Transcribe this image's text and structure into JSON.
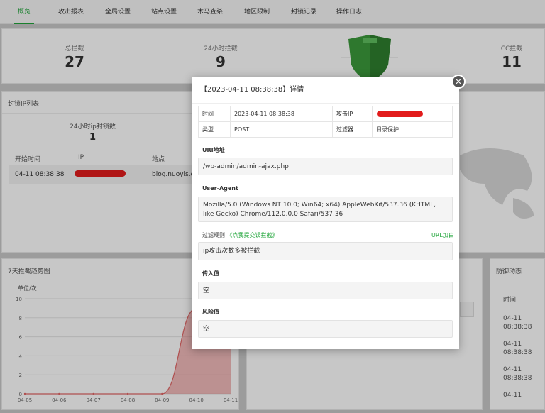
{
  "tabs": [
    "概览",
    "攻击报表",
    "全局设置",
    "站点设置",
    "木马查杀",
    "地区限制",
    "封锁记录",
    "操作日志"
  ],
  "stats": {
    "total_label": "总拦截",
    "total_value": "27",
    "day_label": "24小时拦截",
    "day_value": "9",
    "cc_label": "CC拦截",
    "cc_value": "11"
  },
  "ip_section": {
    "title": "封锁IP列表",
    "blocked_label": "24小时ip封锁数",
    "blocked_value": "1",
    "col_start": "开始时间",
    "col_ip": "IP",
    "col_site": "站点",
    "row_time": "04-11 08:38:38",
    "row_site": "blog.nuoyis.co"
  },
  "trend": {
    "title": "7天拦截趋势图",
    "unit": "单位/次",
    "y_ticks": [
      "0",
      "2",
      "4",
      "6",
      "8",
      "10"
    ],
    "x_ticks": [
      "04-05",
      "04-06",
      "04-07",
      "04-08",
      "04-09",
      "04-10",
      "04-11"
    ]
  },
  "chart_data": {
    "type": "area",
    "categories": [
      "04-05",
      "04-06",
      "04-07",
      "04-08",
      "04-09",
      "04-10",
      "04-11"
    ],
    "values": [
      0,
      0,
      0,
      0,
      0,
      9,
      9
    ],
    "ylim": [
      0,
      10
    ],
    "ylabel": "单位/次",
    "color": "#e06666"
  },
  "defense": {
    "title": "防御动态",
    "col_time": "时间",
    "times": [
      "04-11 08:38:38",
      "04-11 08:38:38",
      "04-11 08:38:38",
      "04-11"
    ]
  },
  "modal": {
    "title": "【2023-04-11 08:38:38】详情",
    "time_label": "时间",
    "time_value": "2023-04-11 08:38:38",
    "attack_ip_label": "攻击IP",
    "type_label": "类型",
    "type_value": "POST",
    "filter_label": "过滤器",
    "filter_value": "目录保护",
    "uri_label": "URI地址",
    "uri_value": "/wp-admin/admin-ajax.php",
    "ua_label": "User-Agent",
    "ua_value": "Mozilla/5.0 (Windows NT 10.0; Win64; x64) AppleWebKit/537.36 (KHTML, like Gecko) Chrome/112.0.0.0 Safari/537.36",
    "rule_label": "过滤规则",
    "rule_link": "《点我提交误拦截》",
    "url_whitelist": "URL加白",
    "rule_value": "ip攻击次数多被拦截",
    "incoming_label": "传入值",
    "incoming_value": "空",
    "risk_label": "风险值",
    "risk_value": "空",
    "close_glyph": "×"
  },
  "colors": {
    "accent": "#20a53a",
    "redact": "#e21b1b",
    "chart": "#e06666"
  }
}
